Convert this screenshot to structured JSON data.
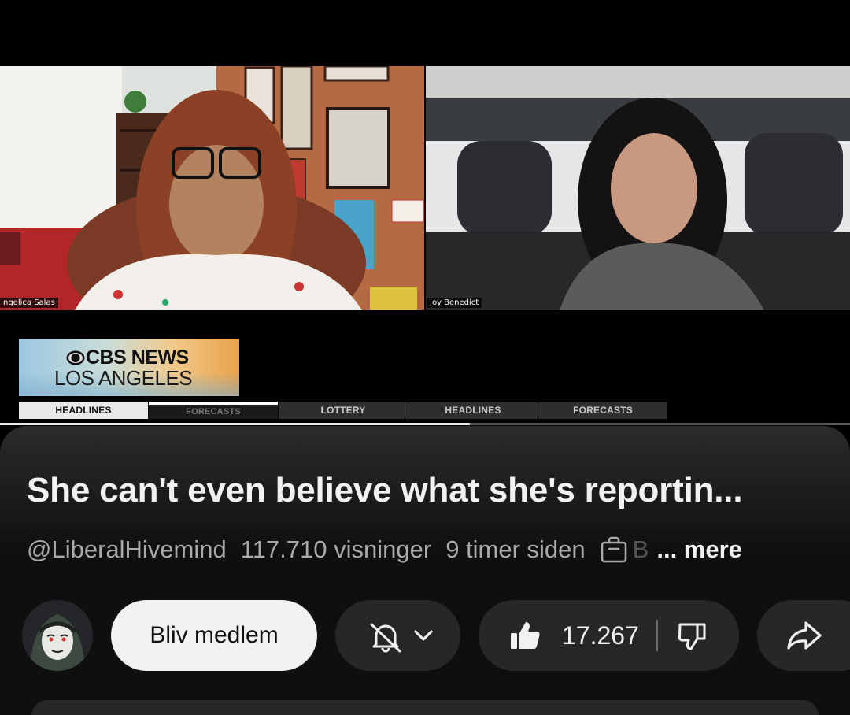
{
  "video": {
    "left_participant": "ngelica Salas",
    "right_participant": "Joy Benedict",
    "broadcast": {
      "brand": "CBS NEWS",
      "city": "LOS ANGELES",
      "ticker_tabs": [
        "HEADLINES",
        "FORECASTS",
        "LOTTERY",
        "HEADLINES",
        "FORECASTS"
      ],
      "active_tab_index": 0
    },
    "progress_fraction": 0.553
  },
  "info": {
    "title": "She can't even believe what she's reportin...",
    "channel_handle": "@LiberalHivemind",
    "views": "117.710 visninger",
    "age": "9 timer siden",
    "faded_text": "B",
    "more_label": "... mere"
  },
  "actions": {
    "join_label": "Bliv medlem",
    "notify_icon": "bell-off-icon",
    "like_icon": "thumbs-up-icon",
    "like_count": "17.267",
    "dislike_icon": "thumbs-down-icon",
    "share_icon": "share-icon"
  },
  "colors": {
    "panel_bg": "#0f0f0f",
    "pill_bg": "#272727",
    "join_bg": "#f1f1f1",
    "meta_text": "#aaaaaa"
  }
}
